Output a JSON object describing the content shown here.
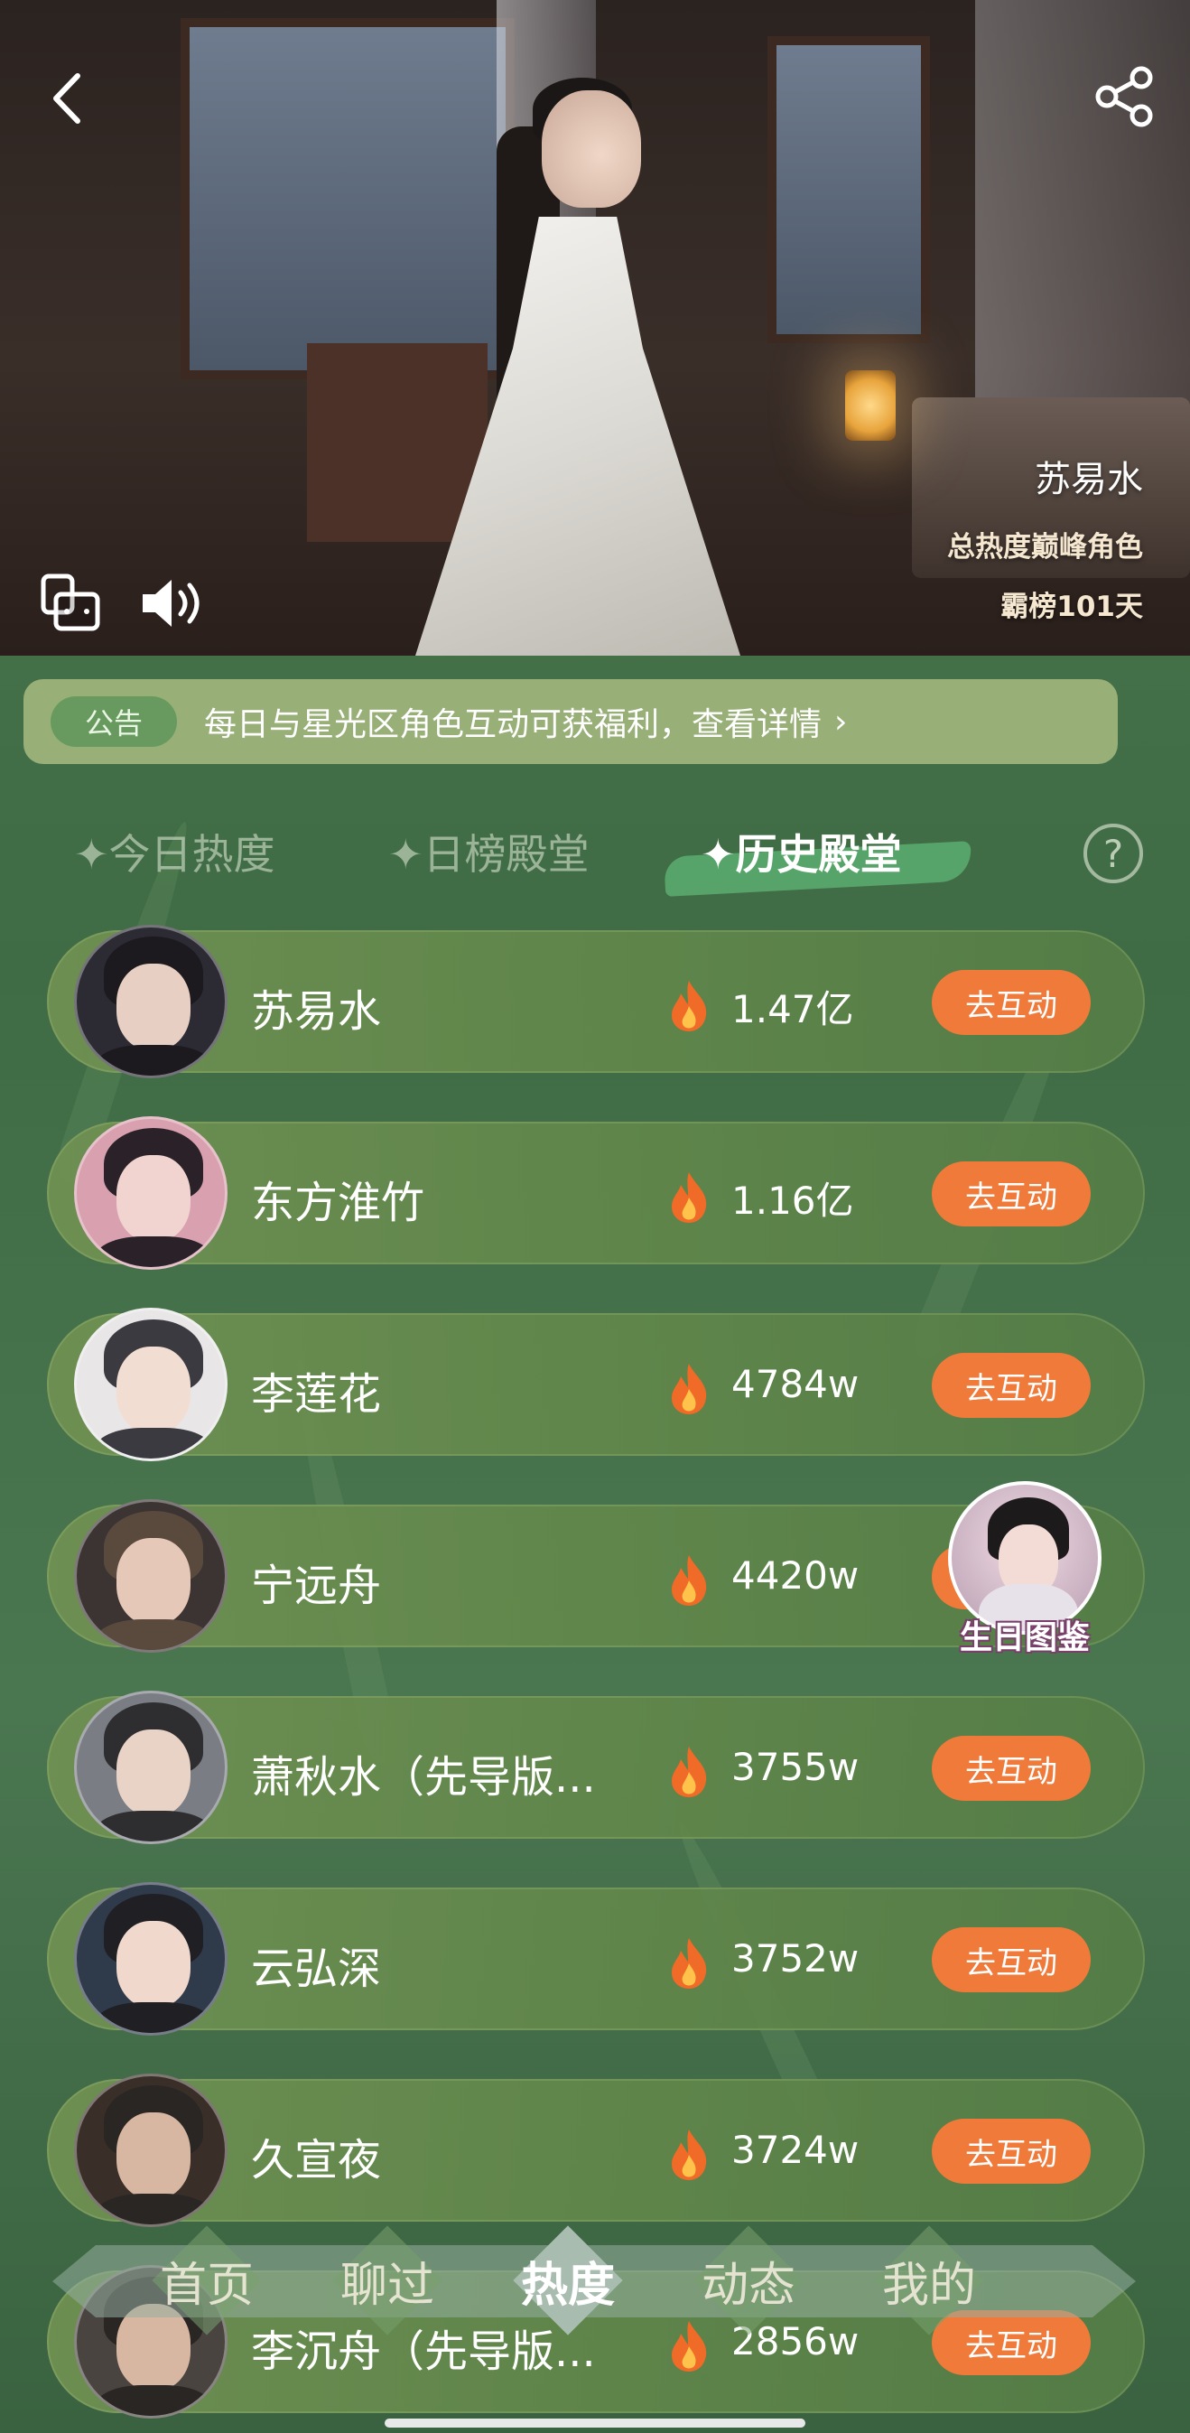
{
  "hero": {
    "character_name": "苏易水",
    "subtitle_1": "总热度巅峰角色",
    "subtitle_2": "霸榜101天"
  },
  "notice": {
    "tag": "公告",
    "text": "每日与星光区角色互动可获福利，查看详情",
    "arrow": "›"
  },
  "tabs": [
    {
      "label": "✦今日热度",
      "active": false
    },
    {
      "label": "✦日榜殿堂",
      "active": false
    },
    {
      "label": "✦历史殿堂",
      "active": true
    }
  ],
  "help": "?",
  "ranking": [
    {
      "name": "苏易水",
      "score": "1.47亿",
      "button": "去互动"
    },
    {
      "name": "东方淮竹",
      "score": "1.16亿",
      "button": "去互动"
    },
    {
      "name": "李莲花",
      "score": "4784w",
      "button": "去互动"
    },
    {
      "name": "宁远舟",
      "score": "4420w",
      "button": "去互动"
    },
    {
      "name": "萧秋水（先导版...",
      "score": "3755w",
      "button": "去互动"
    },
    {
      "name": "云弘深",
      "score": "3752w",
      "button": "去互动"
    },
    {
      "name": "久宣夜",
      "score": "3724w",
      "button": "去互动"
    },
    {
      "name": "李沉舟（先导版...",
      "score": "2856w",
      "button": "去互动"
    }
  ],
  "birthday_badge": "生日图鉴",
  "bottom_nav": [
    {
      "label": "首页",
      "active": false
    },
    {
      "label": "聊过",
      "active": false
    },
    {
      "label": "热度",
      "active": true
    },
    {
      "label": "动态",
      "active": false
    },
    {
      "label": "我的",
      "active": false
    }
  ],
  "colors": {
    "accent_button": "#f07a3a",
    "background_green": "#4a7650",
    "notice_bg": "#cdd696"
  }
}
